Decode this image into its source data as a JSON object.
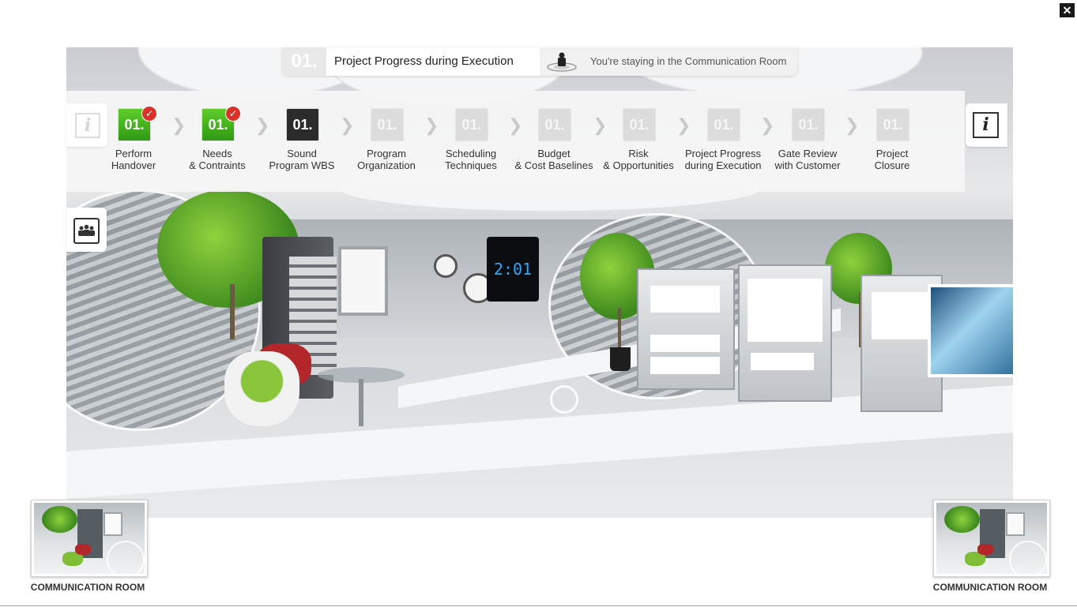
{
  "window": {
    "close_label": "✕"
  },
  "header": {
    "step_number": "01.",
    "title": "Project Progress during Execution",
    "location_text": "You're staying in the Communication Room"
  },
  "info_icon_label": "i",
  "steps": [
    {
      "number": "01.",
      "label_line1": "Perform",
      "label_line2": "Handover",
      "status": "done"
    },
    {
      "number": "01.",
      "label_line1": "Needs",
      "label_line2": "& Contraints",
      "status": "done"
    },
    {
      "number": "01.",
      "label_line1": "Sound",
      "label_line2": "Program WBS",
      "status": "current"
    },
    {
      "number": "01.",
      "label_line1": "Program",
      "label_line2": "Organization",
      "status": "todo"
    },
    {
      "number": "01.",
      "label_line1": "Scheduling",
      "label_line2": "Techniques",
      "status": "todo"
    },
    {
      "number": "01.",
      "label_line1": "Budget",
      "label_line2": "& Cost Baselines",
      "status": "todo"
    },
    {
      "number": "01.",
      "label_line1": "Risk",
      "label_line2": "& Opportunities",
      "status": "todo"
    },
    {
      "number": "01.",
      "label_line1": "Project Progress",
      "label_line2": "during Execution",
      "status": "todo"
    },
    {
      "number": "01.",
      "label_line1": "Gate Review",
      "label_line2": "with Customer",
      "status": "todo"
    },
    {
      "number": "01.",
      "label_line1": "Project",
      "label_line2": "Closure",
      "status": "todo"
    }
  ],
  "scene": {
    "clock_display": "2:01"
  },
  "thumbnails": {
    "left_caption": "COMMUNICATION ROOM",
    "right_caption": "COMMUNICATION ROOM"
  },
  "colors": {
    "done": "#3fae1a",
    "current": "#2b2b2b",
    "todo": "#dcdcdc",
    "check": "#d8322b"
  }
}
